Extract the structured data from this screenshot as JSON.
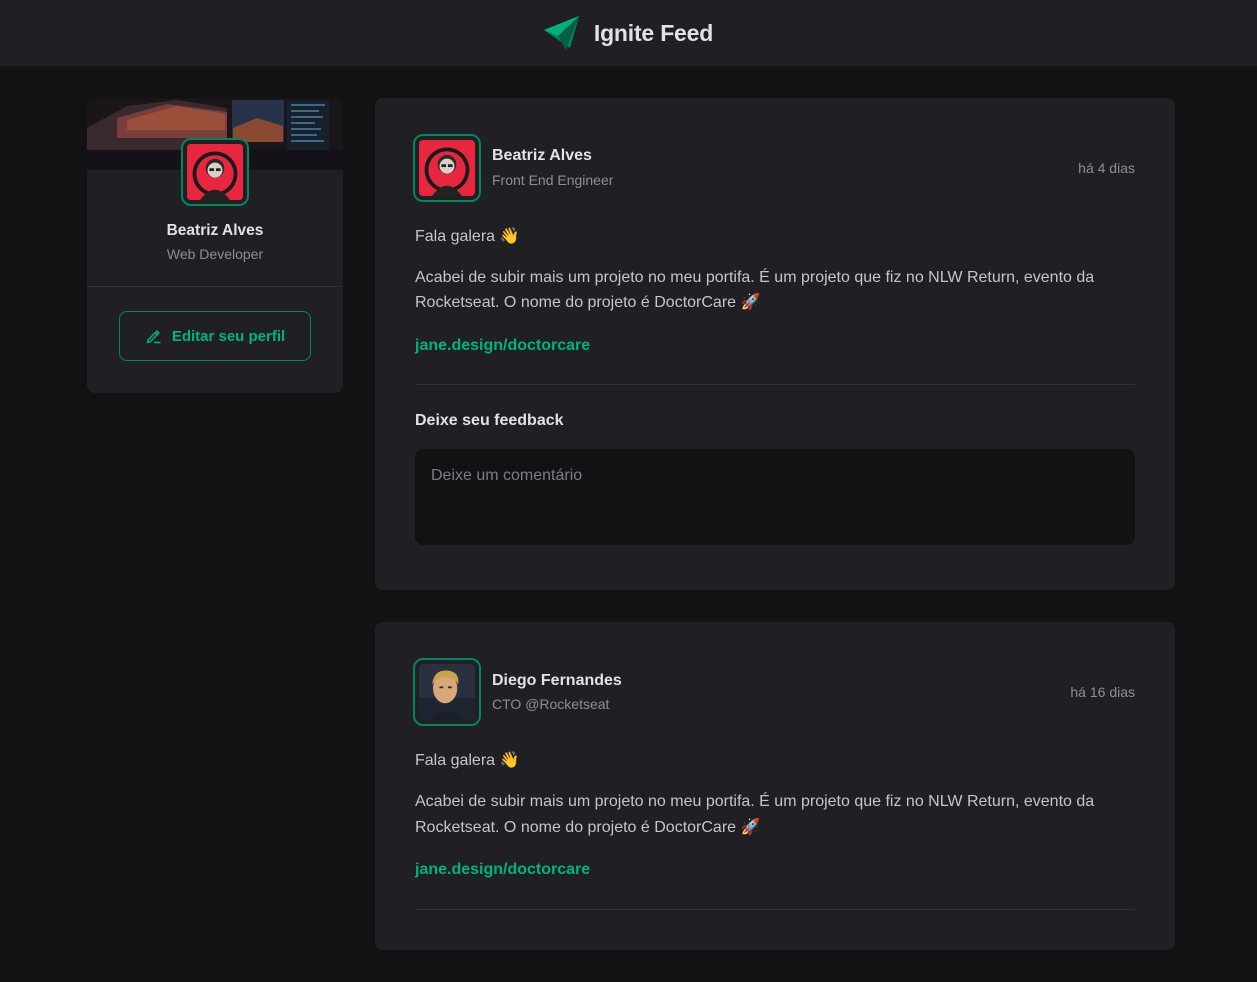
{
  "header": {
    "title": "Ignite Feed",
    "logo_icon": "paper-plane-logo-icon"
  },
  "sidebar": {
    "cover_image": "desk-setup-cover",
    "avatar_icon": "user-avatar",
    "name": "Beatriz Alves",
    "role": "Web Developer",
    "edit_button": "Editar seu perfil",
    "edit_icon": "pencil-icon"
  },
  "posts": [
    {
      "author": {
        "name": "Beatriz Alves",
        "role": "Front End Engineer"
      },
      "time": "há 4 dias",
      "paragraphs": [
        "Fala galera 👋",
        "Acabei de subir mais um projeto no meu portifa. É um projeto que fiz no NLW Return, evento da Rocketseat. O nome do projeto é DoctorCare 🚀"
      ],
      "link": "jane.design/doctorcare",
      "form_title": "Deixe seu feedback",
      "comment_placeholder": "Deixe um comentário"
    },
    {
      "author": {
        "name": "Diego Fernandes",
        "role": "CTO @Rocketseat"
      },
      "time": "há 16 dias",
      "paragraphs": [
        "Fala galera 👋",
        "Acabei de subir mais um projeto no meu portifa. É um projeto que fiz no NLW Return, evento da Rocketseat. O nome do projeto é DoctorCare 🚀"
      ],
      "link": "jane.design/doctorcare"
    }
  ],
  "colors": {
    "background": "#121214",
    "panel": "#202024",
    "accent": "#00b37e",
    "accent_border": "#00875f",
    "text": "#e1e1e6",
    "muted": "#8d8d99"
  }
}
